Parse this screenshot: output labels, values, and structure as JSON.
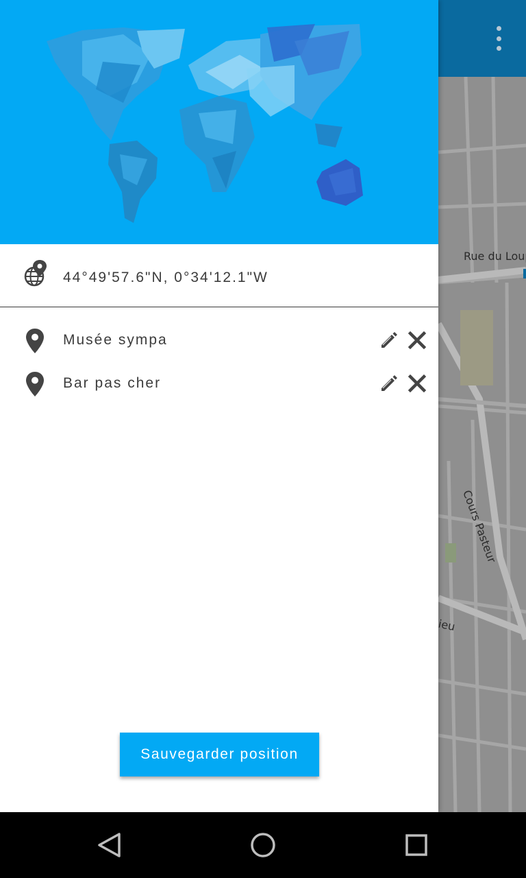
{
  "toolbar": {
    "overflow_icon": "more-vert-icon",
    "color": "#0a6a9f"
  },
  "map": {
    "street_labels": [
      "Rue du Loup",
      "Cours Pasteur",
      "ieu"
    ]
  },
  "drawer": {
    "header_color": "#03a9f4",
    "header_image": "world-map-polygon-illustration",
    "current_position": {
      "icon": "globe-pin-icon",
      "coordinates": "44°49'57.6\"N, 0°34'12.1\"W"
    },
    "places": [
      {
        "icon": "place-pin-icon",
        "label": "Musée sympa",
        "edit_icon": "pencil-icon",
        "delete_icon": "close-icon"
      },
      {
        "icon": "place-pin-icon",
        "label": "Bar pas cher",
        "edit_icon": "pencil-icon",
        "delete_icon": "close-icon"
      }
    ],
    "save_button_label": "Sauvegarder position"
  },
  "navbar": {
    "back_icon": "back-triangle-icon",
    "home_icon": "home-circle-icon",
    "recents_icon": "recents-square-icon"
  }
}
